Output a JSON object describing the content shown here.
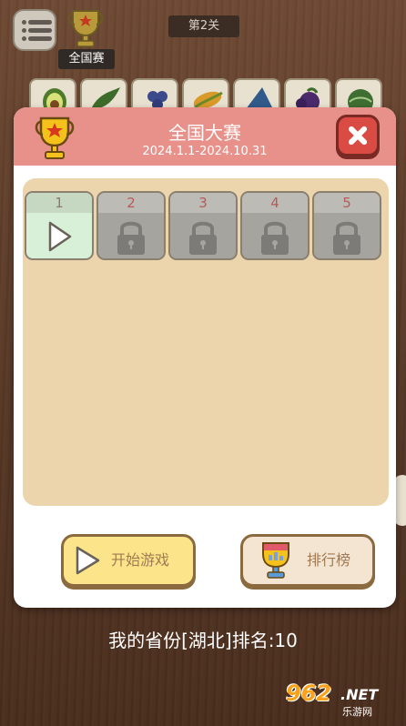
{
  "top_bar": {
    "trophy_label": "全国赛",
    "level_label": "第2关"
  },
  "fruits": [
    "avocado",
    "herb",
    "grapes",
    "corn",
    "cheese",
    "eggplant",
    "lettuce"
  ],
  "dialog": {
    "title": "全国大赛",
    "date_range": "2024.1.1-2024.10.31",
    "levels": [
      {
        "number": "1",
        "state": "open"
      },
      {
        "number": "2",
        "state": "locked"
      },
      {
        "number": "3",
        "state": "locked"
      },
      {
        "number": "4",
        "state": "locked"
      },
      {
        "number": "5",
        "state": "locked"
      }
    ],
    "start_label": "开始游戏",
    "rank_label": "排行榜"
  },
  "province_rank": "我的省份[湖北]排名:10",
  "watermark": {
    "brand": "962",
    "suffix": ".NET",
    "site": "乐游网"
  },
  "colors": {
    "header": "#e8918a",
    "panel": "#ecd5ac",
    "close": "#d94b43",
    "start_button": "#fbe48a"
  }
}
